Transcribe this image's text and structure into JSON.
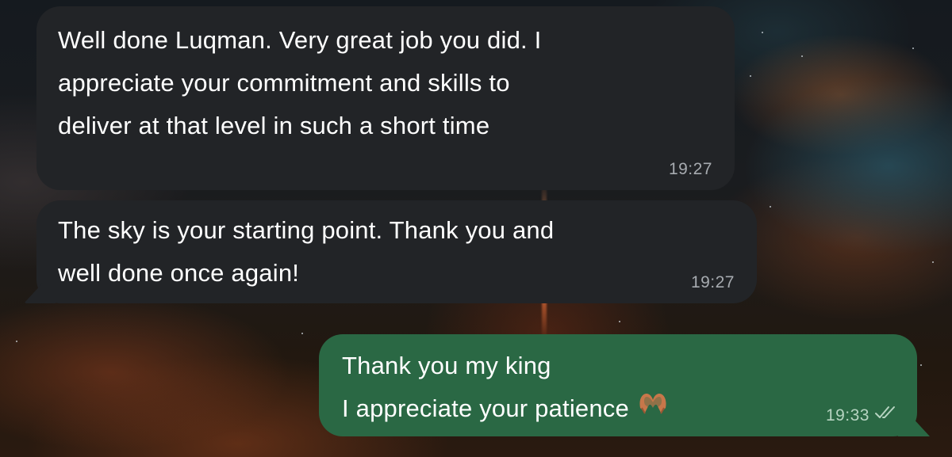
{
  "chat": {
    "messages": [
      {
        "direction": "incoming",
        "lines": [
          "Well done Luqman. Very great job you did. I",
          "appreciate your commitment and skills to",
          "deliver at that level in such a short time"
        ],
        "time": "19:27"
      },
      {
        "direction": "incoming",
        "lines": [
          "The sky is your starting point. Thank you and",
          "well done once again!"
        ],
        "time": "19:27"
      },
      {
        "direction": "outgoing",
        "lines": [
          "Thank you my king",
          "I appreciate your patience"
        ],
        "emoji": "heart-hands-emoji",
        "time": "19:33",
        "status_icon": "double-check-icon"
      }
    ]
  },
  "colors": {
    "incoming_bubble": "#222427",
    "outgoing_bubble": "#2a6844",
    "text": "#ffffff"
  }
}
